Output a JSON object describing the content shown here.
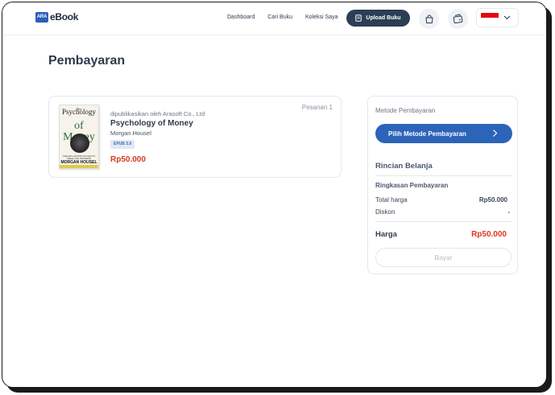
{
  "header": {
    "logo_mark": "ARA",
    "logo_text": "eBook",
    "nav": [
      "Dashboard",
      "Cari Buku",
      "Koleksi Saya"
    ],
    "upload_label": "Upload Buku"
  },
  "page": {
    "title": "Pembayaran"
  },
  "order": {
    "order_number": "Pesanan 1",
    "publisher": "dipublikasikan oleh Arasoft Co., Ltd",
    "book_title": "Psychology of Money",
    "author": "Morgan Housel",
    "format": "EPUB 3.0",
    "price": "Rp50.000",
    "cover": {
      "line0": "The",
      "line1": "Psychology",
      "line2": "of Money",
      "tagline": "TIMELESS LESSONS ON WEALTH, GREED, AND HAPPINESS",
      "author": "MORGAN HOUSEL"
    }
  },
  "payment": {
    "method_label": "Metode Pembayaran",
    "method_button": "Pilih Metode Pembayaran",
    "details_title": "Rincian Belanja",
    "summary_title": "Ringkasan Pembayaran",
    "rows": [
      {
        "label": "Total harga",
        "value": "Rp50.000"
      },
      {
        "label": "Diskon",
        "value": "-"
      }
    ],
    "total_label": "Harga",
    "total_value": "Rp50.000",
    "pay_button": "Bayar"
  },
  "colors": {
    "primary": "#2c64b9",
    "dark": "#2c3e55",
    "price": "#d93a1f"
  }
}
